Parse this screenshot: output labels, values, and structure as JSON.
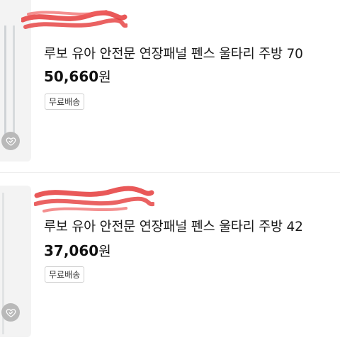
{
  "listings": [
    {
      "seller": "",
      "title": "루보 유아 안전문 연장패널 펜스 울타리 주방 70",
      "price": "50,660",
      "currency": "원",
      "badge": "무료배송"
    },
    {
      "seller": "",
      "title": "루보 유아 안전문 연장패널 펜스 울타리 주방 42",
      "price": "37,060",
      "currency": "원",
      "badge": "무료배송"
    }
  ],
  "icons": {
    "wishlist": "heart-check-icon"
  },
  "colors": {
    "redaction": "#e53b3b",
    "wishlist_bg": "#b9b9b9"
  }
}
